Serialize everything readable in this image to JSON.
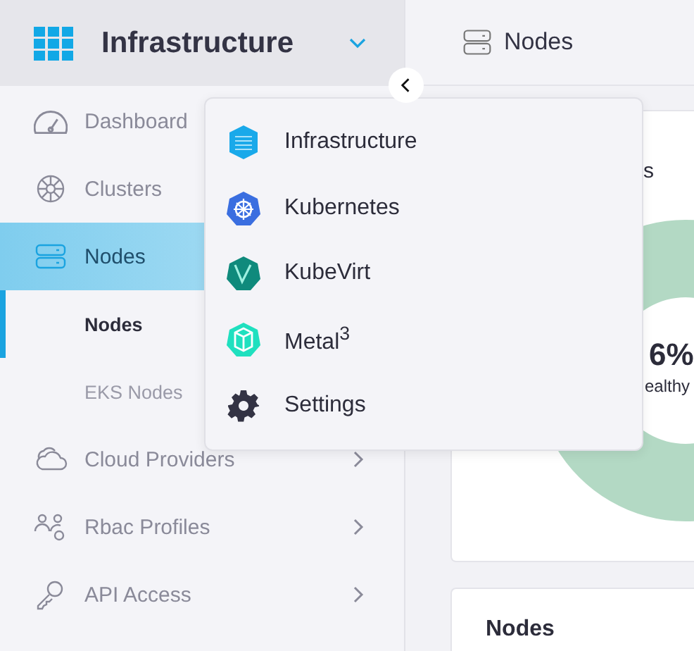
{
  "sidebar": {
    "title": "Infrastructure",
    "items": [
      {
        "label": "Dashboard",
        "kind": "item",
        "selected": false
      },
      {
        "label": "Clusters",
        "kind": "item",
        "selected": false
      },
      {
        "label": "Nodes",
        "kind": "item",
        "selected": true
      },
      {
        "label": "Nodes",
        "kind": "sub",
        "selected": true
      },
      {
        "label": "EKS Nodes",
        "kind": "sub",
        "selected": false
      },
      {
        "label": "Cloud Providers",
        "kind": "item",
        "selected": false,
        "expandable": true
      },
      {
        "label": "Rbac Profiles",
        "kind": "item",
        "selected": false,
        "expandable": true
      },
      {
        "label": "API Access",
        "kind": "item",
        "selected": false,
        "expandable": true
      }
    ]
  },
  "header": {
    "title": "Nodes"
  },
  "product_menu": {
    "items": [
      "Infrastructure",
      "Kubernetes",
      "KubeVirt",
      "Metal$^{3}$",
      "Settings"
    ]
  },
  "health_card": {
    "title_fragment": "s",
    "value_fragment": "6%",
    "caption_fragment": "ealthy"
  },
  "nodes_card": {
    "title": "Nodes"
  }
}
